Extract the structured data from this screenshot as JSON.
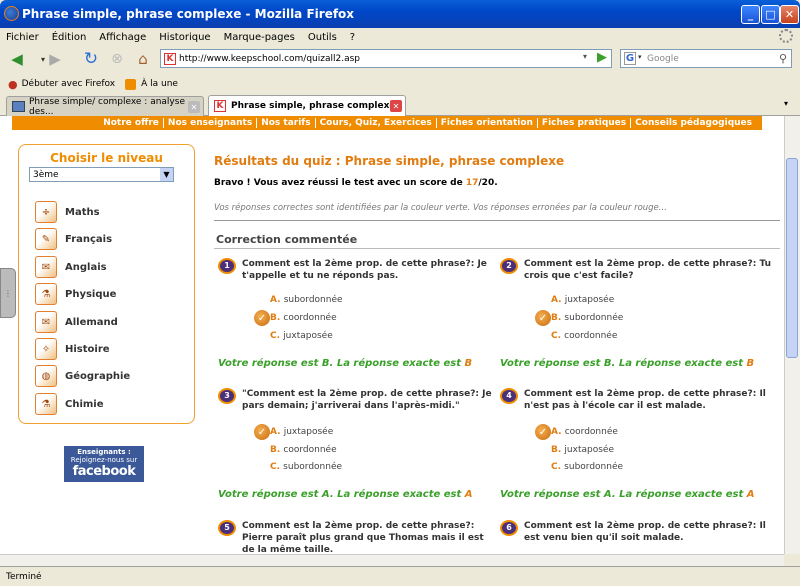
{
  "window": {
    "title": "Phrase simple, phrase complexe - Mozilla Firefox"
  },
  "menu": [
    "Fichier",
    "Édition",
    "Affichage",
    "Historique",
    "Marque-pages",
    "Outils",
    "?"
  ],
  "address": {
    "url": "http://www.keepschool.com/quizall2.asp"
  },
  "search": {
    "placeholder": "Google"
  },
  "bookmarks": [
    "Débuter avec Firefox",
    "À la une"
  ],
  "tabs": [
    {
      "label": "Phrase simple/ complexe : analyse des..."
    },
    {
      "label": "Phrase simple, phrase complexe"
    }
  ],
  "status": "Terminé",
  "site_nav": [
    "Notre offre",
    "Nos enseignants",
    "Nos tarifs",
    "Cours, Quiz, Exercices",
    "Fiches orientation",
    "Fiches pratiques",
    "Conseils pédagogiques"
  ],
  "sidebar": {
    "title": "Choisir le niveau",
    "level": "3ème",
    "subjects": [
      "Maths",
      "Français",
      "Anglais",
      "Physique",
      "Allemand",
      "Histoire",
      "Géographie",
      "Chimie"
    ],
    "fb_top": "Enseignants :",
    "fb_mid": "Rejoignez-nous sur",
    "fb_big": "facebook"
  },
  "results": {
    "title": "Résultats du quiz : Phrase simple, phrase complexe",
    "bravo_prefix": "Bravo ! Vous avez réussi le test avec un score de ",
    "score": "17",
    "total": "/20.",
    "note": "Vos réponses correctes sont identifiées par la couleur verte. Vos réponses erronées par la couleur rouge...",
    "correction": "Correction commentée"
  },
  "questions": [
    {
      "num": "1",
      "text": "Comment est la 2ème prop. de cette phrase?: Je t'appelle et tu ne réponds pas.",
      "options": [
        "subordonnée",
        "coordonnée",
        "juxtaposée"
      ],
      "answer_prefix": "Votre réponse est B. La réponse exacte est ",
      "answer": "B"
    },
    {
      "num": "2",
      "text": "Comment est la 2ème prop. de cette phrase?: Tu crois que c'est facile?",
      "options": [
        "juxtaposée",
        "subordonnée",
        "coordonnée"
      ],
      "answer_prefix": "Votre réponse est B. La réponse exacte est ",
      "answer": "B"
    },
    {
      "num": "3",
      "text": "\"Comment est la 2ème prop. de cette phrase?: Je pars demain; j'arriverai dans l'après-midi.\"",
      "options": [
        "juxtaposée",
        "coordonnée",
        "subordonnée"
      ],
      "answer_prefix": "Votre réponse est A. La réponse exacte est ",
      "answer": "A"
    },
    {
      "num": "4",
      "text": "Comment est la 2ème prop. de cette phrase?: Il n'est pas à l'école car il est malade.",
      "options": [
        "coordonnée",
        "juxtaposée",
        "subordonnée"
      ],
      "answer_prefix": "Votre réponse est A. La réponse exacte est ",
      "answer": "A"
    },
    {
      "num": "5",
      "text": "Comment est la 2ème prop. de cette phrase?: Pierre paraît plus grand que Thomas mais il est de la même taille.",
      "options": [],
      "answer_prefix": "",
      "answer": ""
    },
    {
      "num": "6",
      "text": "Comment est la 2ème prop. de cette phrase?: Il est venu bien qu'il soit malade.",
      "options": [],
      "answer_prefix": "",
      "answer": ""
    }
  ]
}
